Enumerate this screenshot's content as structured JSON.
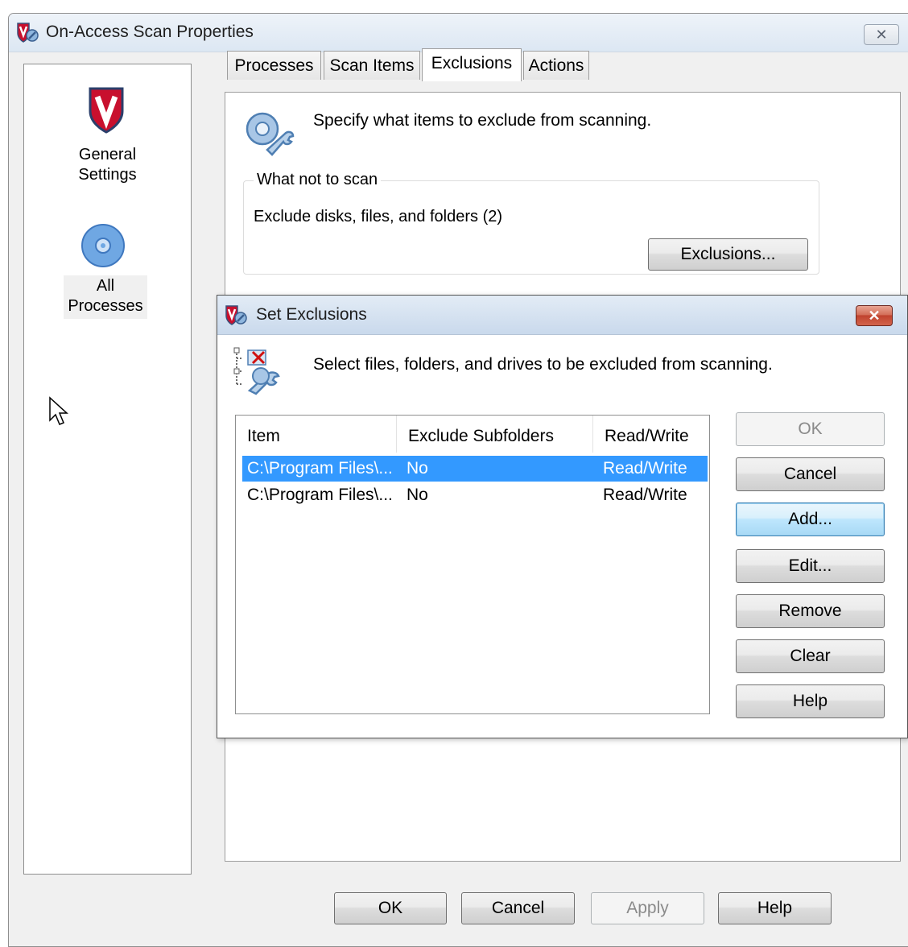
{
  "main_window": {
    "title": "On-Access Scan Properties",
    "close_glyph": "✕",
    "nav": [
      {
        "label_line1": "General",
        "label_line2": "Settings",
        "icon": "mcafee-shield-icon"
      },
      {
        "label_line1": "All",
        "label_line2": "Processes",
        "icon": "disc-icon"
      }
    ],
    "tabs": [
      "Processes",
      "Scan Items",
      "Exclusions",
      "Actions"
    ],
    "active_tab": "Exclusions",
    "description": "Specify what items to exclude from scanning.",
    "group_title": "What not to scan",
    "group_text": "Exclude disks, files, and folders (2)",
    "exclusions_button": "Exclusions...",
    "footer_buttons": {
      "ok": "OK",
      "cancel": "Cancel",
      "apply": "Apply",
      "help": "Help"
    }
  },
  "dialog": {
    "title": "Set Exclusions",
    "close_glyph": "✕",
    "description": "Select files, folders, and drives to be excluded from scanning.",
    "columns": [
      "Item",
      "Exclude Subfolders",
      "Read/Write"
    ],
    "rows": [
      {
        "item": "C:\\Program Files\\...",
        "subfolders": "No",
        "rw": "Read/Write",
        "selected": true
      },
      {
        "item": "C:\\Program Files\\...",
        "subfolders": "No",
        "rw": "Read/Write",
        "selected": false
      }
    ],
    "buttons": {
      "ok": "OK",
      "cancel": "Cancel",
      "add": "Add...",
      "edit": "Edit...",
      "remove": "Remove",
      "clear": "Clear",
      "help": "Help"
    }
  },
  "colors": {
    "selection": "#3399ff",
    "brand_red": "#c8102e",
    "titlebar": "#dce7f3"
  }
}
